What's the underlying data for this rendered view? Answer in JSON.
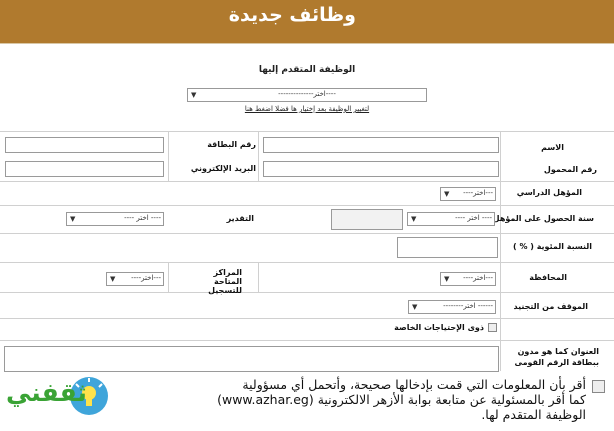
{
  "header": {
    "title": "وظائف جديدة"
  },
  "job": {
    "title": "الوظيفة المتقدم إليها",
    "select_value": "----اختر--------------",
    "note": "لتغيير الوظيفة بعد إختيار ها فضلا اضغط هنا"
  },
  "form": {
    "name_label": "الاسم",
    "card_label": "رقم البطاقة",
    "mobile_label": "رقم المحمول",
    "email_label": "البريد الإلكتروني",
    "qualification_label": "المؤهل الدراسي",
    "qualification_value": "---اختر----",
    "year_label": "سنة الحصول على المؤهل",
    "year_value": "---- اختر ----",
    "grade_label": "التقدير",
    "grade_value": "---- اختر ----",
    "percent_label": "النسبة المئوية ( % )",
    "governorate_label": "المحافظة",
    "governorate_value": "---اختر----",
    "centers_label": "المراكز المتاحة للتسجيل",
    "centers_value": "---اختر----",
    "military_label": "الموقف من التجنيد",
    "military_value": "------ اختر--------",
    "special_needs_label": "ذوى الإحتياجات الخاصة",
    "address_label": "العنوان كما هو مدون ببطاقة الرقم القومى"
  },
  "declaration": {
    "line1": "أقر بأن المعلومات التي قمت بإدخالها صحيحة، وأتحمل أي مسؤولية",
    "line2": "كما أقر بالمسئولية عن متابعة بوابة الأزهر الالكترونية (www.azhar.eg)",
    "line3": "الوظيفة المتقدم لها."
  },
  "logo": {
    "text": "ثقفني",
    "icon": "lightbulb-icon"
  },
  "colors": {
    "header": "#b07a2e"
  }
}
